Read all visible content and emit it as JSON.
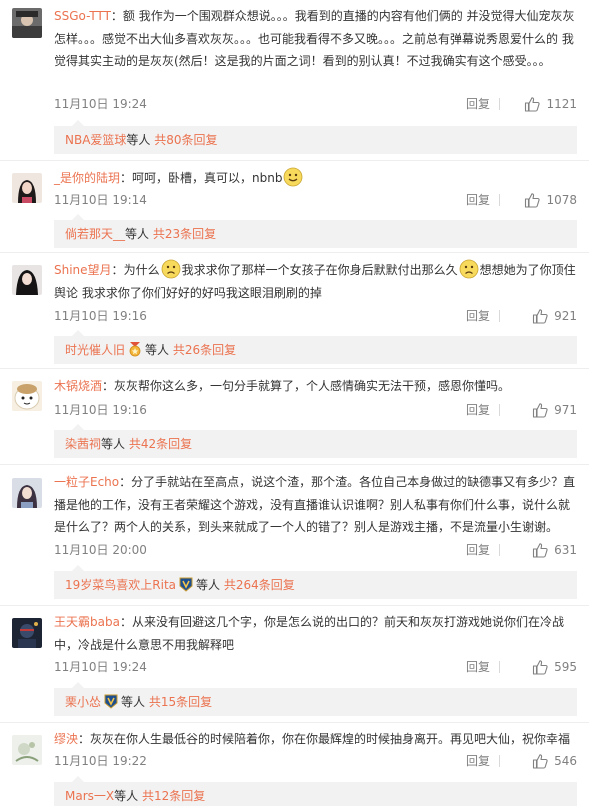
{
  "comments": [
    {
      "username": "SSGo-TTT",
      "text": "额 我作为一个围观群众想说。。。我看到的直播的内容有他们俩的 并没觉得大仙宠灰灰怎样。。。感觉不出大仙多喜欢灰灰。。。也可能我看得不多又晚。。。之前总有弹幕说秀恩爱什么的 我觉得其实主动的是灰灰(然后！这是我的片面之词！看到的别认真！不过我确实有这个感受。。。",
      "time": "11月10日 19:24",
      "reply_label": "回复",
      "likes": "1121",
      "sub": {
        "user": "NBA爱篮球",
        "mid": "等人",
        "count": "共80条回复"
      }
    },
    {
      "username": "_是你的陆玥",
      "text": "呵呵，卧槽，真可以，nbnb",
      "time": "11月10日 19:14",
      "reply_label": "回复",
      "likes": "1078",
      "sub": {
        "user": "倘若那天__",
        "mid": "等人",
        "count": "共23条回复"
      }
    },
    {
      "username": "Shine望月",
      "text_parts": [
        "为什么",
        "我求求你了那样一个女孩子在你身后默默付出那么久",
        "想想她为了你顶住舆论 我求求你了你们好好的好吗我这眼泪刷刷的掉"
      ],
      "time": "11月10日 19:16",
      "reply_label": "回复",
      "likes": "921",
      "sub": {
        "user": "时光催人旧",
        "mid": "等人",
        "count": "共26条回复"
      }
    },
    {
      "username": "木锅烧酒",
      "text": "灰灰帮你这么多，一句分手就算了，个人感情确实无法干预，感恩你懂吗。",
      "time": "11月10日 19:16",
      "reply_label": "回复",
      "likes": "971",
      "sub": {
        "user": "染茜祠",
        "mid": "等人",
        "count": "共42条回复"
      }
    },
    {
      "username": "一粒子Echo",
      "text": "分了手就站在至高点，说这个渣，那个渣。各位自己本身做过的缺德事又有多少？直播是他的工作，没有王者荣耀这个游戏，没有直播谁认识谁啊？别人私事有你们什么事，说什么就是什么了？两个人的关系，到头来就成了一个人的错了？别人是游戏主播，不是流量小生谢谢。",
      "time": "11月10日 20:00",
      "reply_label": "回复",
      "likes": "631",
      "sub": {
        "user": "19岁菜鸟喜欢上Rita",
        "mid": "等人",
        "count": "共264条回复"
      }
    },
    {
      "username": "王天霸baba",
      "text": "从来没有回避这几个字，你是怎么说的出口的？前天和灰灰打游戏她说你们在冷战中，冷战是什么意思不用我解释吧",
      "time": "11月10日 19:24",
      "reply_label": "回复",
      "likes": "595",
      "sub": {
        "user": "栗小怂",
        "mid": "等人",
        "count": "共15条回复"
      }
    },
    {
      "username": "缪泱",
      "text": "灰灰在你人生最低谷的时候陪着你，你在你最辉煌的时候抽身离开。再见吧大仙，祝你幸福",
      "time": "11月10日 19:22",
      "reply_label": "回复",
      "likes": "546",
      "sub": {
        "user": "Mars一X",
        "mid": "等人",
        "count": "共12条回复"
      }
    }
  ],
  "colors": {
    "link": "#eb7350",
    "meta": "#808080",
    "sub_bg": "#f2f2f2",
    "text": "#333333"
  }
}
